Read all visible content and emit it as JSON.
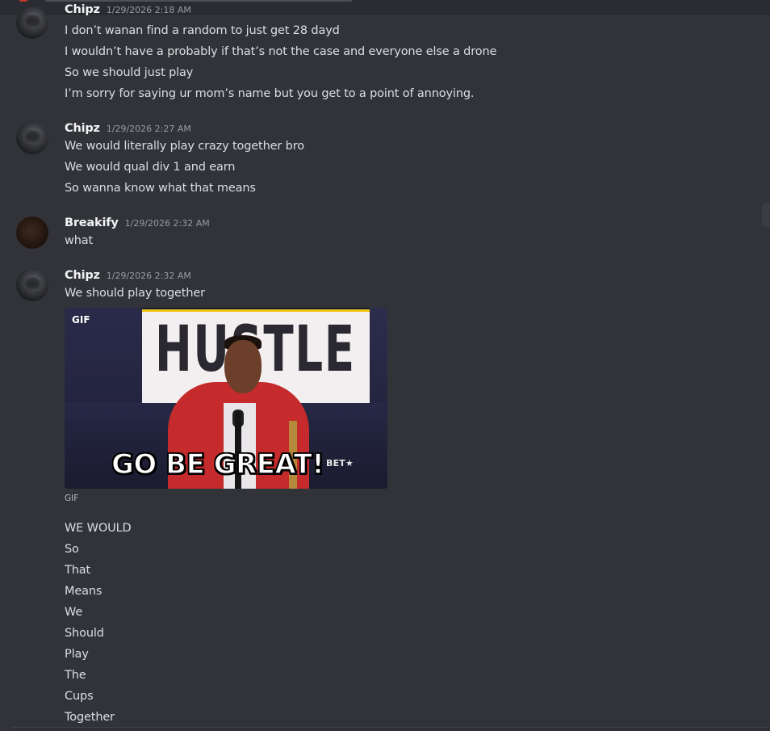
{
  "colors": {
    "background": "#323339",
    "text": "#dbdee1",
    "username": "#f2f3f5",
    "timestamp": "#949ba4"
  },
  "messages": [
    {
      "author": "Chipz",
      "timestamp": "1/29/2026 2:18 AM",
      "avatar_icon": "chipz-avatar",
      "lines": [
        "I don’t wanan find a random to just get 28 dayd",
        "I wouldn’t have a probably if that’s not the case and everyone else a drone",
        "So we should just play",
        "I’m sorry for saying ur mom’s name but you get to a point of annoying."
      ]
    },
    {
      "author": "Chipz",
      "timestamp": "1/29/2026 2:27 AM",
      "avatar_icon": "chipz-avatar",
      "lines": [
        "We would literally play crazy together bro",
        "We would qual div 1 and earn",
        "So wanna know what that means"
      ]
    },
    {
      "author": "Breakify",
      "timestamp": "1/29/2026 2:32 AM",
      "avatar_icon": "breakify-avatar",
      "lines": [
        "what"
      ]
    },
    {
      "author": "Chipz",
      "timestamp": "1/29/2026 2:32 AM",
      "avatar_icon": "chipz-avatar",
      "lines": [
        "We should play together"
      ],
      "gif": {
        "badge": "GIF",
        "sign_text": "HUSTLE",
        "caption": "GO BE GREAT!",
        "watermark": "BET★",
        "label": "GIF"
      },
      "after_lines": [
        "WE WOULD",
        "So",
        "That",
        "Means",
        "We",
        "Should",
        "Play",
        "The",
        "Cups",
        "Together"
      ]
    }
  ]
}
